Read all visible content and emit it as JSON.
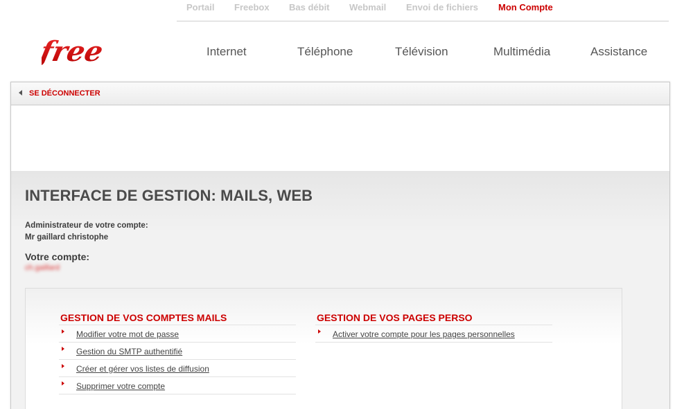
{
  "topnav": {
    "items": [
      "Portail",
      "Freebox",
      "Bas débit",
      "Webmail",
      "Envoi de fichiers",
      "Mon Compte"
    ],
    "active": "Mon Compte"
  },
  "logo": {
    "text": "free"
  },
  "mainnav": {
    "items": [
      "Internet",
      "Téléphone",
      "Télévision",
      "Multimédia",
      "Assistance"
    ]
  },
  "panel": {
    "logout_label": "SE DÉCONNECTER",
    "title": "INTERFACE DE GESTION: MAILS, WEB",
    "admin_label": "Administrateur de votre compte:",
    "admin_name": "Mr gaillard christophe",
    "account_label": "Votre compte:",
    "account_value": "ch.gaillard"
  },
  "mails": {
    "title": "GESTION DE VOS COMPTES MAILS",
    "links": [
      "Modifier votre mot de passe",
      "Gestion du SMTP authentifié",
      "Créer et gérer vos listes de diffusion",
      "Supprimer votre compte"
    ]
  },
  "pages_perso": {
    "title": "GESTION DE VOS PAGES PERSO",
    "links": [
      "Activer votre compte pour les pages personnelles"
    ]
  },
  "colors": {
    "brand_red": "#cc0000",
    "muted_nav": "#c7c7c7",
    "text_dark": "#4a4a4a",
    "panel_bg": "#efefef"
  }
}
